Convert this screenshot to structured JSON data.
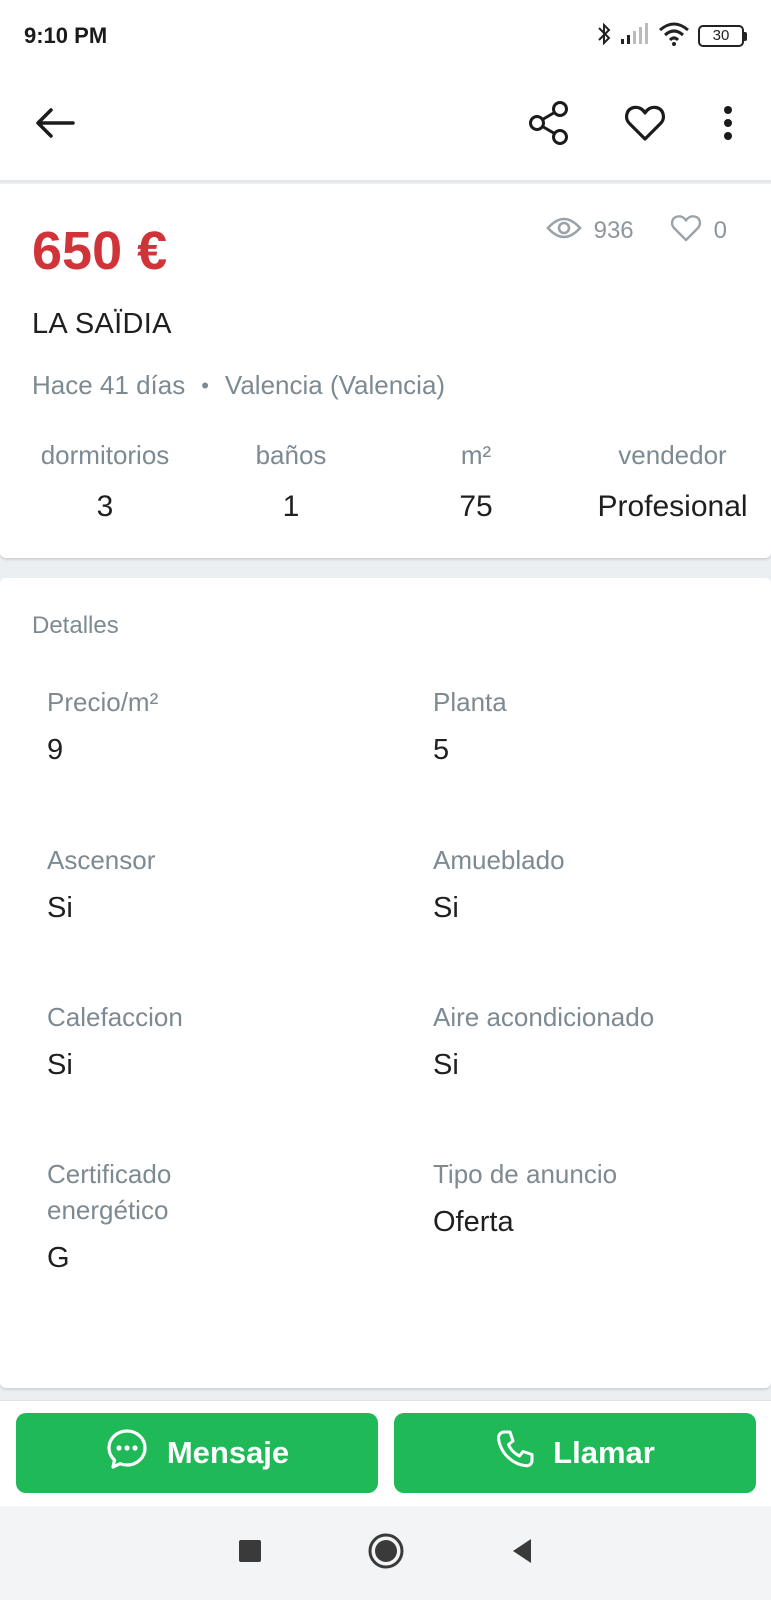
{
  "status_bar": {
    "time": "9:10 PM",
    "battery": "30",
    "icons": [
      "bluetooth-icon",
      "signal-icon",
      "wifi-icon",
      "battery-icon"
    ]
  },
  "app_bar": {
    "icons": [
      "back-arrow-icon",
      "share-icon",
      "heart-icon",
      "more-vert-icon"
    ]
  },
  "listing": {
    "price": "650 €",
    "views": "936",
    "favorites": "0",
    "title": "LA SAÏDIA",
    "posted": "Hace 41 días",
    "separator": "•",
    "location": "Valencia (Valencia)",
    "specs": [
      {
        "label": "dormitorios",
        "value": "3"
      },
      {
        "label": "baños",
        "value": "1"
      },
      {
        "label": "m²",
        "value": "75"
      },
      {
        "label": "vendedor",
        "value": "Profesional"
      }
    ]
  },
  "details": {
    "heading": "Detalles",
    "items": [
      {
        "label": "Precio/m²",
        "value": "9"
      },
      {
        "label": "Planta",
        "value": "5"
      },
      {
        "label": "Ascensor",
        "value": "Si"
      },
      {
        "label": "Amueblado",
        "value": "Si"
      },
      {
        "label": "Calefaccion",
        "value": "Si"
      },
      {
        "label": "Aire acondicionado",
        "value": "Si"
      },
      {
        "label": "Certificado energético",
        "value": "G"
      },
      {
        "label": "Tipo de anuncio",
        "value": "Oferta"
      }
    ]
  },
  "actions": {
    "message_label": "Mensaje",
    "call_label": "Llamar"
  },
  "colors": {
    "price": "#d13438",
    "action_green": "#1fba57",
    "muted_text": "#7d8a92",
    "background": "#eceff1"
  }
}
